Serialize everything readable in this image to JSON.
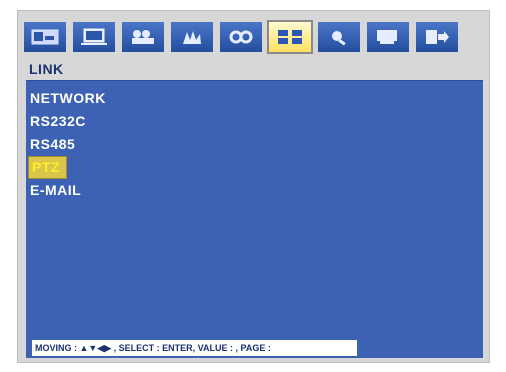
{
  "toolbar": {
    "tabs": [
      {
        "name": "display-tab",
        "icon": "display-icon",
        "active": false
      },
      {
        "name": "monitor-tab",
        "icon": "monitor-icon",
        "active": false
      },
      {
        "name": "camera-tab",
        "icon": "camera-icon",
        "active": false
      },
      {
        "name": "motion-tab",
        "icon": "hand-icon",
        "active": false
      },
      {
        "name": "device-tab",
        "icon": "gears-icon",
        "active": false
      },
      {
        "name": "link-tab",
        "icon": "link-icon",
        "active": true
      },
      {
        "name": "search-tab",
        "icon": "search-icon",
        "active": false
      },
      {
        "name": "system-tab",
        "icon": "system-icon",
        "active": false
      },
      {
        "name": "exit-tab",
        "icon": "exit-icon",
        "active": false
      }
    ]
  },
  "page": {
    "title": "LINK"
  },
  "menu": {
    "items": [
      {
        "label": "NETWORK",
        "selected": false
      },
      {
        "label": "RS232C",
        "selected": false
      },
      {
        "label": "RS485",
        "selected": false
      },
      {
        "label": "PTZ",
        "selected": true
      },
      {
        "label": "E-MAIL",
        "selected": false
      }
    ]
  },
  "status": {
    "text": "MOVING : ▲▼◀▶ , SELECT : ENTER, VALUE :   , PAGE :"
  },
  "colors": {
    "panel": "#3d62b4",
    "selected_text": "#ffee00",
    "title": "#1b3170"
  }
}
